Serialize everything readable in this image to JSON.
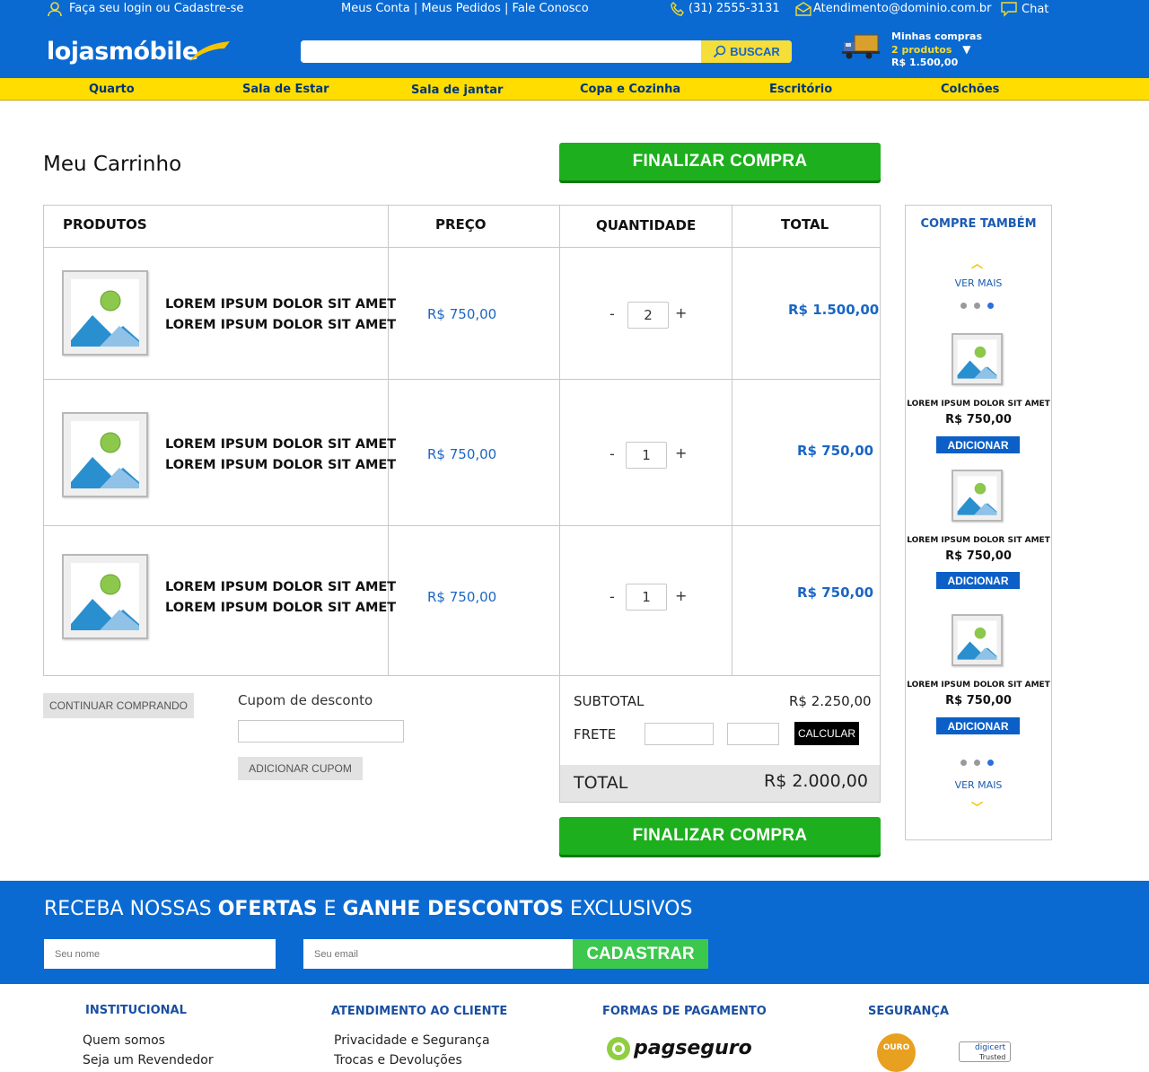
{
  "topbar": {
    "login": "Faça seu login ou Cadastre-se",
    "account_links": "Meus Conta | Meus Pedidos | Fale Conosco",
    "phone": "(31) 2555-3131",
    "email": "Atendimento@dominio.com.br",
    "chat": "Chat"
  },
  "header": {
    "logo": "lojasmóbile",
    "search_placeholder": "",
    "search_button": "BUSCAR",
    "cart_title": "Minhas compras",
    "cart_count": "2 produtos",
    "cart_total": "R$ 1.500,00"
  },
  "nav": [
    "Quarto",
    "Sala de Estar",
    "Sala de jantar",
    "Copa e Cozinha",
    "Escritório",
    "Colchões"
  ],
  "cart": {
    "title": "Meu Carrinho",
    "checkout_label": "FINALIZAR COMPRA",
    "columns": [
      "PRODUTOS",
      "PREÇO",
      "QUANTIDADE",
      "TOTAL"
    ],
    "items": [
      {
        "name_line1": "LOREM IPSUM DOLOR SIT AMET",
        "name_line2": "LOREM IPSUM DOLOR SIT AMET",
        "price": "R$ 750,00",
        "qty": "2",
        "total": "R$ 1.500,00"
      },
      {
        "name_line1": "LOREM IPSUM DOLOR SIT AMET",
        "name_line2": "LOREM IPSUM DOLOR SIT AMET",
        "price": "R$ 750,00",
        "qty": "1",
        "total": "R$ 750,00"
      },
      {
        "name_line1": "LOREM IPSUM DOLOR SIT AMET",
        "name_line2": "LOREM IPSUM DOLOR SIT AMET",
        "price": "R$ 750,00",
        "qty": "1",
        "total": "R$ 750,00"
      }
    ],
    "qty_minus": "-",
    "qty_plus": "+",
    "continue_label": "CONTINUAR COMPRANDO",
    "coupon_label": "Cupom de desconto",
    "coupon_value": "",
    "coupon_button": "ADICIONAR CUPOM",
    "subtotal_label": "SUBTOTAL",
    "subtotal_value": "R$ 2.250,00",
    "frete_label": "FRETE",
    "calc_button": "CALCULAR",
    "total_label": "TOTAL",
    "total_value": "R$ 2.000,00"
  },
  "side": {
    "title": "COMPRE TAMBÉM",
    "ver_mais": "VER MAIS",
    "products": [
      {
        "name": "LOREM IPSUM DOLOR SIT AMET",
        "price": "R$ 750,00",
        "button": "ADICIONAR"
      },
      {
        "name": "LOREM IPSUM DOLOR SIT AMET",
        "price": "R$ 750,00",
        "button": "ADICIONAR"
      },
      {
        "name": "LOREM IPSUM DOLOR SIT AMET",
        "price": "R$ 750,00",
        "button": "ADICIONAR"
      }
    ]
  },
  "newsletter": {
    "title_a": "RECEBA NOSSAS ",
    "title_b": "OFERTAS",
    "title_c": " E ",
    "title_d": "GANHE DESCONTOS",
    "title_e": " EXCLUSIVOS",
    "name_placeholder": "Seu nome",
    "email_placeholder": "Seu email",
    "button": "CADASTRAR"
  },
  "footer": {
    "col1_title": "INSTITUCIONAL",
    "col1_links": [
      "Quem somos",
      "Seja um Revendedor"
    ],
    "col2_title": "ATENDIMENTO AO CLIENTE",
    "col2_links": [
      "Privacidade e Segurança",
      "Trocas e Devoluções"
    ],
    "col3_title": "FORMAS DE PAGAMENTO",
    "pagseguro": "pagseguro",
    "col4_title": "SEGURANÇA",
    "ouro": "OURO",
    "digicert": "digicert",
    "trusted": "Trusted"
  },
  "colors": {
    "brand_blue": "#0a6ad2",
    "nav_yellow": "#ffdd00",
    "green": "#1daf1d"
  }
}
